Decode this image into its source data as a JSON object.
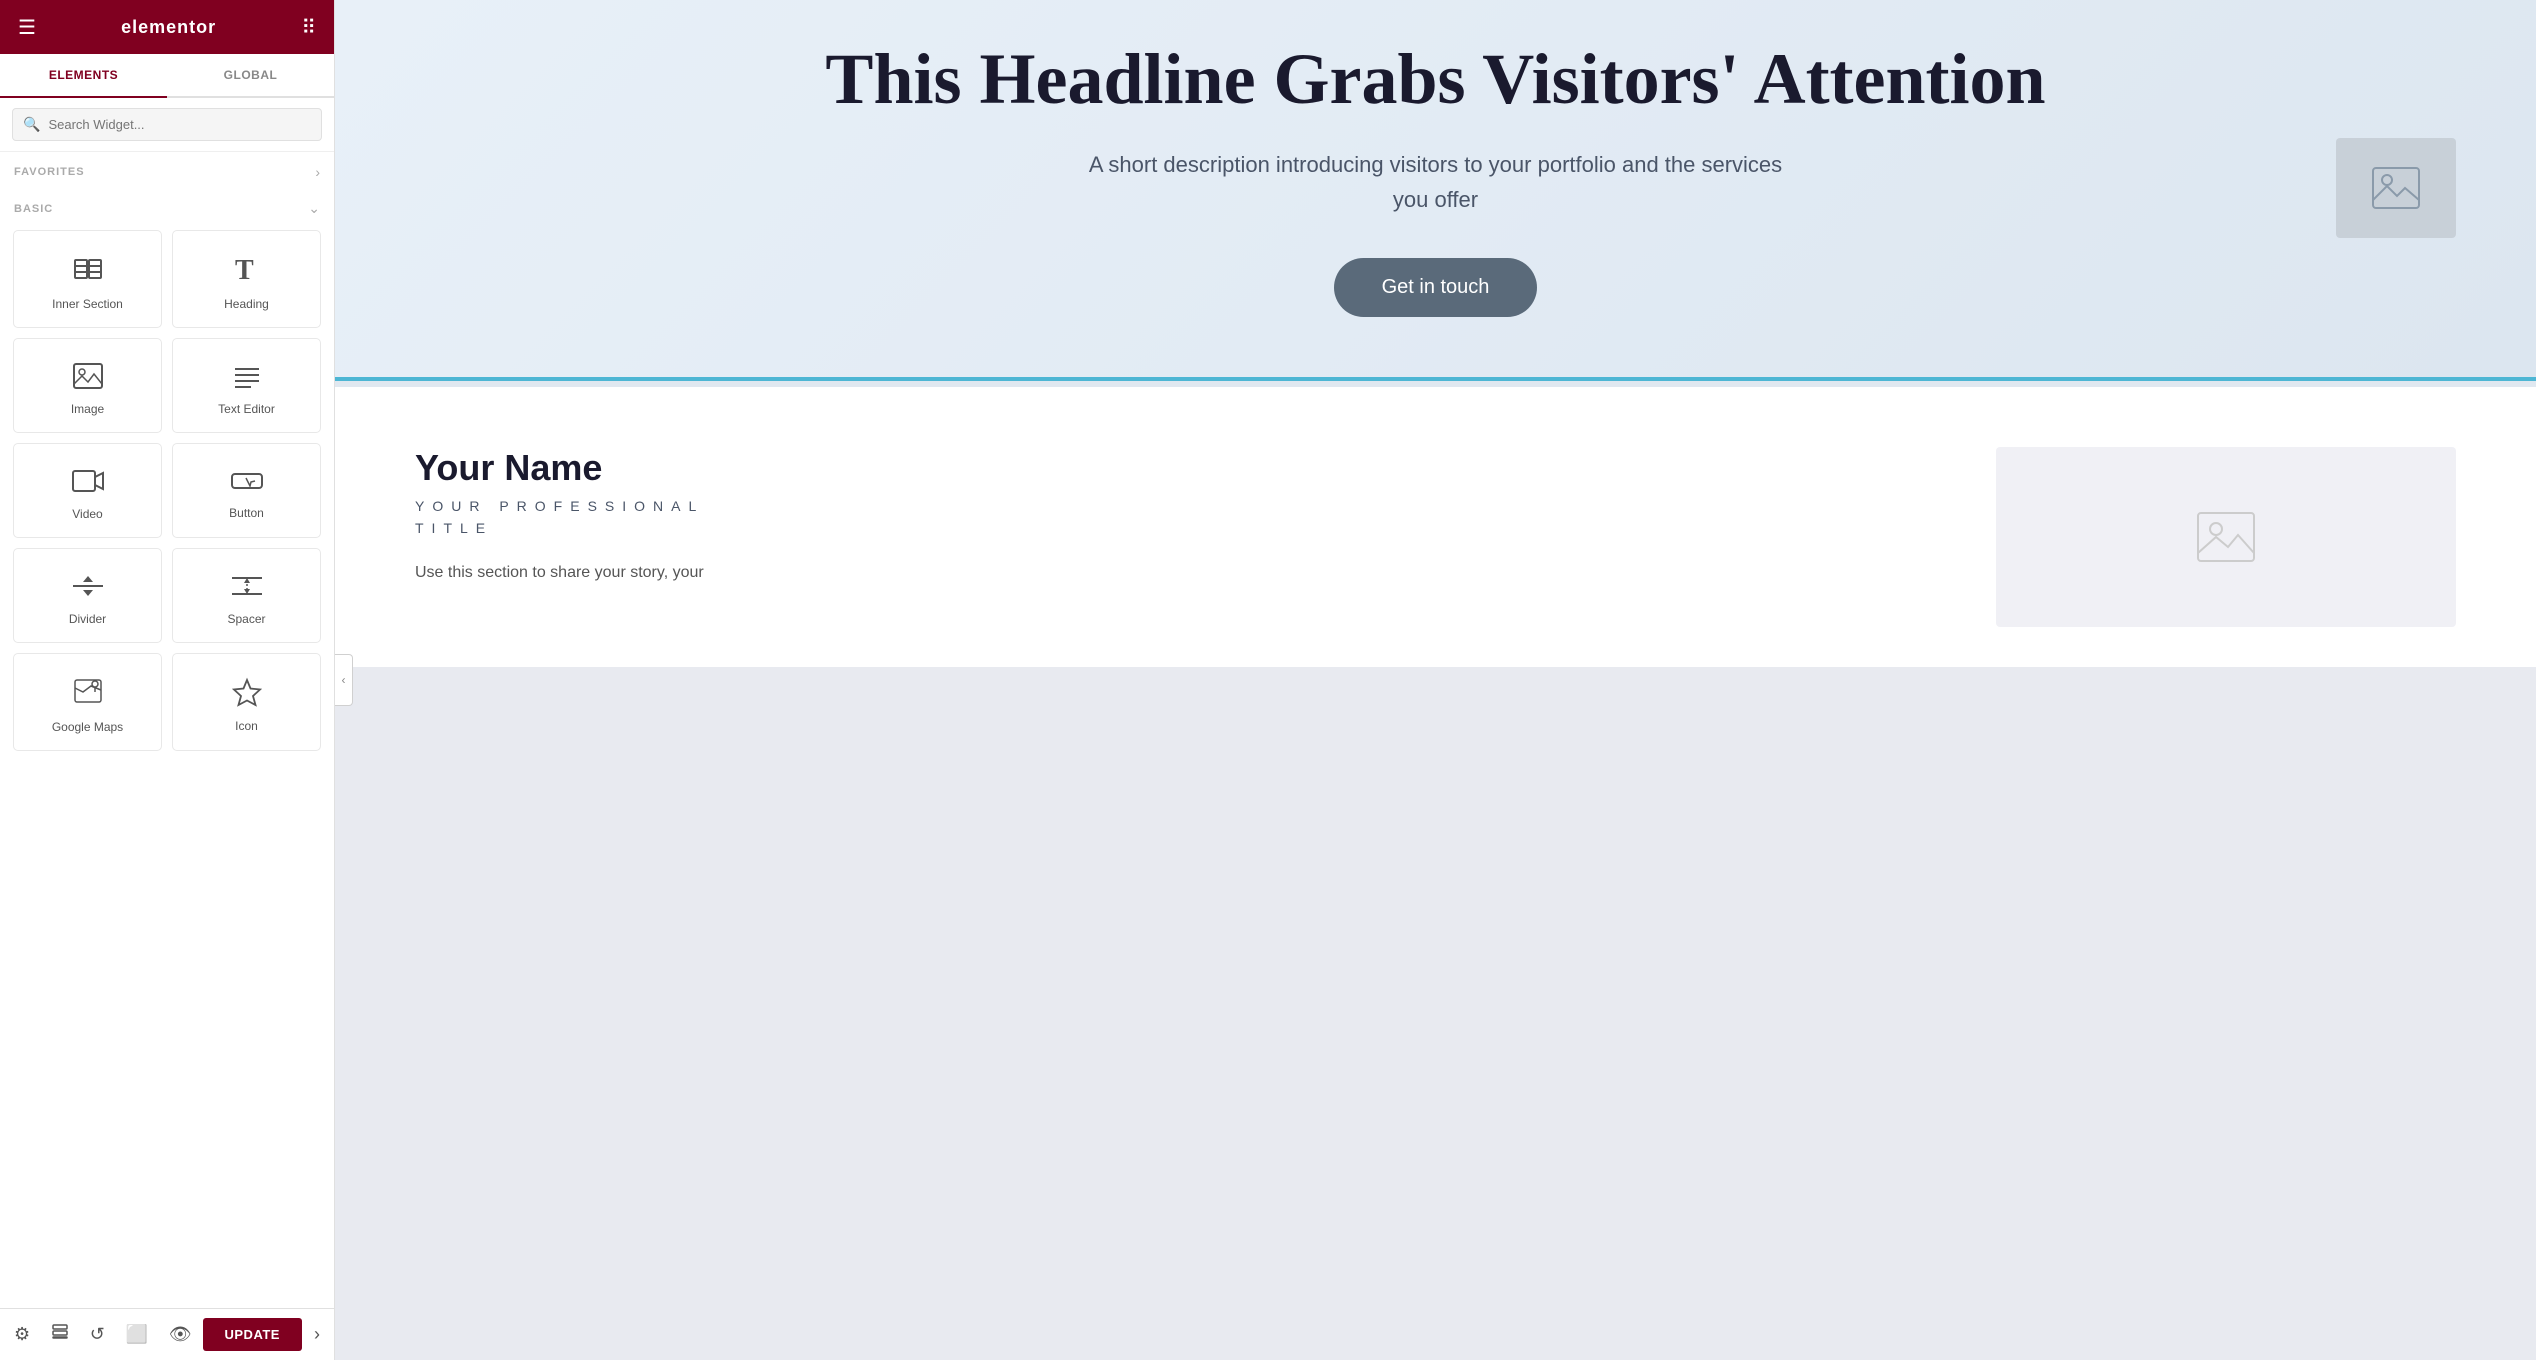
{
  "sidebar": {
    "logo": "elementor",
    "tabs": [
      {
        "label": "ELEMENTS",
        "active": true
      },
      {
        "label": "GLOBAL",
        "active": false
      }
    ],
    "search": {
      "placeholder": "Search Widget..."
    },
    "sections": [
      {
        "label": "FAVORITES",
        "collapsed": true,
        "widgets": []
      },
      {
        "label": "BASIC",
        "collapsed": false,
        "widgets": [
          {
            "name": "inner-section",
            "label": "Inner Section",
            "icon": "inner-section-icon"
          },
          {
            "name": "heading",
            "label": "Heading",
            "icon": "heading-icon"
          },
          {
            "name": "image",
            "label": "Image",
            "icon": "image-icon"
          },
          {
            "name": "text-editor",
            "label": "Text Editor",
            "icon": "text-editor-icon"
          },
          {
            "name": "video",
            "label": "Video",
            "icon": "video-icon"
          },
          {
            "name": "button",
            "label": "Button",
            "icon": "button-icon"
          },
          {
            "name": "divider",
            "label": "Divider",
            "icon": "divider-icon"
          },
          {
            "name": "spacer",
            "label": "Spacer",
            "icon": "spacer-icon"
          },
          {
            "name": "google-maps",
            "label": "Google Maps",
            "icon": "maps-icon"
          },
          {
            "name": "icon",
            "label": "Icon",
            "icon": "icon-icon"
          }
        ]
      }
    ],
    "footer": {
      "update_label": "UPDATE"
    }
  },
  "canvas": {
    "hero": {
      "headline": "This Headline Grabs Visitors' Attention",
      "subtext": "A short description introducing visitors to your portfolio and the services you offer",
      "button_label": "Get in touch"
    },
    "about": {
      "name": "Your Name",
      "title": "YOUR PROFESSIONAL\nTITLE",
      "description": "Use this section to share your story, your"
    }
  },
  "icons": {
    "hamburger": "☰",
    "grid": "⠿",
    "search": "🔍",
    "chevron_right": "›",
    "chevron_down": "⌄",
    "collapse": "‹",
    "settings": "⚙",
    "layers": "⊞",
    "history": "↺",
    "responsive": "⬜",
    "preview": "👁",
    "footer_chevron": "›"
  }
}
